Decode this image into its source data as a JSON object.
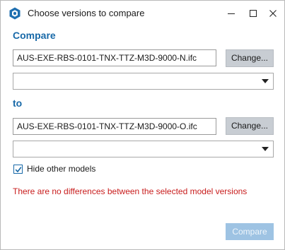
{
  "window": {
    "title": "Choose versions to compare",
    "app_icon": "app-logo-icon",
    "controls": [
      "minimize-icon",
      "maximize-icon",
      "close-icon"
    ]
  },
  "compare": {
    "label": "Compare",
    "file": "AUS-EXE-RBS-0101-TNX-TTZ-M3D-9000-N.ifc",
    "change_label": "Change...",
    "version_select": ""
  },
  "to": {
    "label": "to",
    "file": "AUS-EXE-RBS-0101-TNX-TTZ-M3D-9000-O.ifc",
    "change_label": "Change...",
    "version_select": ""
  },
  "options": {
    "hide_other_models_label": "Hide other models",
    "hide_other_models_checked": true
  },
  "message": "There are no differences between the selected model versions",
  "footer": {
    "compare_label": "Compare",
    "compare_enabled": false
  },
  "colors": {
    "accent": "#1869a8",
    "error": "#c81c1c",
    "button": "#c8cdd3",
    "disabled_primary": "#9ec3e3"
  }
}
